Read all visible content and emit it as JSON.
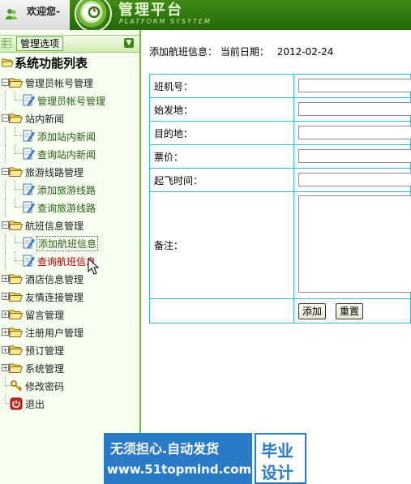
{
  "header": {
    "welcome": "欢迎您-",
    "title": "管理平台",
    "subtitle": "PLATFORM SYSYTEM"
  },
  "sidebar": {
    "header_label": "管理选项",
    "root_label": "系统功能列表",
    "groups": [
      {
        "label": "管理员帐号管理",
        "children": [
          "管理员帐号管理"
        ]
      },
      {
        "label": "站内新闻",
        "children": [
          "添加站内新闻",
          "查询站内新闻"
        ]
      },
      {
        "label": "旅游线路管理",
        "children": [
          "添加旅游线路",
          "查询旅游线路"
        ]
      },
      {
        "label": "航班信息管理",
        "children": [
          "添加航班信息",
          "查询航班信息"
        ]
      },
      {
        "label": "酒店信息管理"
      },
      {
        "label": "友情连接管理"
      },
      {
        "label": "留言管理"
      },
      {
        "label": "注册用户管理"
      },
      {
        "label": "预订管理"
      },
      {
        "label": "系统管理"
      }
    ],
    "tools": [
      "修改密码",
      "退出"
    ]
  },
  "main": {
    "title": "添加航班信息：",
    "date_label": "当前日期：",
    "date_value": "2012-02-24",
    "fields": [
      {
        "label": "班机号："
      },
      {
        "label": "始发地："
      },
      {
        "label": "目的地："
      },
      {
        "label": "票价："
      },
      {
        "label": "起飞时间："
      },
      {
        "label": "备注："
      }
    ],
    "buttons": {
      "add": "添加",
      "reset": "重置"
    }
  },
  "watermark": {
    "line1": "无须担心.自动发货",
    "line2": "www.51topmind.com",
    "badge1": "毕业",
    "badge2": "设计"
  }
}
